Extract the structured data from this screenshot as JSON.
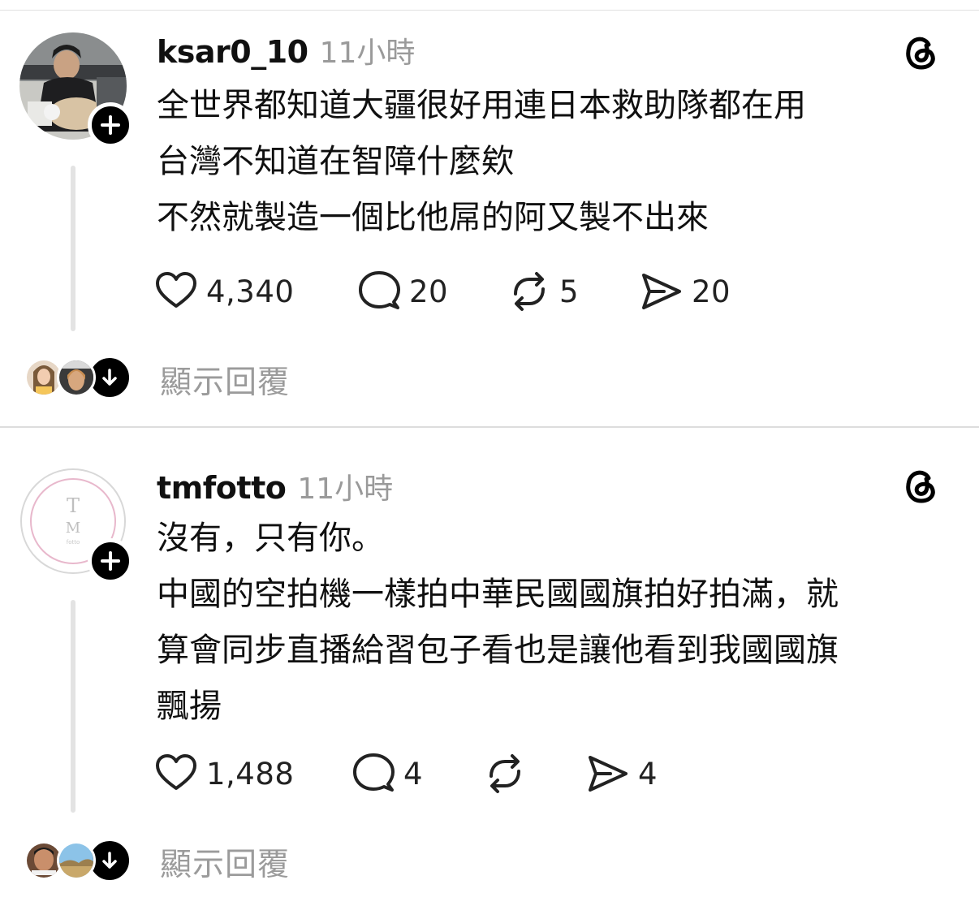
{
  "posts": [
    {
      "username": "ksar0_10",
      "time": "11小時",
      "lines": [
        "全世界都知道大疆很好用連日本救助隊都在用",
        "台灣不知道在智障什麼欸",
        "不然就製造一個比他屌的阿又製不出來"
      ],
      "likes": "4,340",
      "comments": "20",
      "reposts": "5",
      "shares": "20",
      "show_replies": "顯示回覆"
    },
    {
      "username": "tmfotto",
      "time": "11小時",
      "avatar_letters": {
        "top": "T",
        "mid": "M",
        "bottom": "fotto"
      },
      "lines": [
        "沒有，只有你。",
        "中國的空拍機一樣拍中華民國國旗拍好拍滿，就",
        "算會同步直播給習包子看也是讓他看到我國國旗",
        "飄揚"
      ],
      "likes": "1,488",
      "comments": "4",
      "reposts": "",
      "shares": "4",
      "show_replies": "顯示回覆"
    }
  ],
  "icons": {
    "like": "heart-icon",
    "comment": "comment-bubble-icon",
    "repost": "repost-icon",
    "share": "send-icon",
    "threads": "threads-logo-icon",
    "follow": "plus-icon",
    "expand": "arrow-down-icon"
  },
  "colors": {
    "text": "#101010",
    "muted": "#9a9a9a",
    "thread_line": "#e3e3e3",
    "avatar_accent": "#e8b8cc"
  }
}
